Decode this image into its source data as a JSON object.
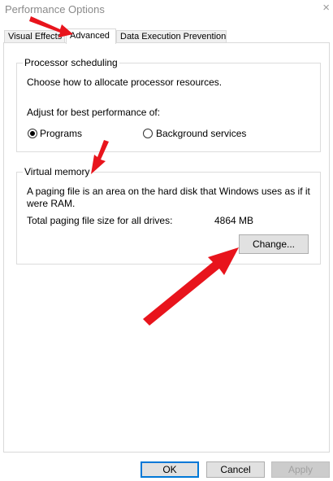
{
  "window": {
    "title": "Performance Options",
    "close_glyph": "×"
  },
  "tabs": [
    {
      "label": "Visual Effects"
    },
    {
      "label": "Advanced"
    },
    {
      "label": "Data Execution Prevention"
    }
  ],
  "processor_scheduling": {
    "title": "Processor scheduling",
    "description": "Choose how to allocate processor resources.",
    "adjust_label": "Adjust for best performance of:",
    "options": [
      {
        "label": "Programs",
        "selected": true
      },
      {
        "label": "Background services",
        "selected": false
      }
    ]
  },
  "virtual_memory": {
    "title": "Virtual memory",
    "description_line1": "A paging file is an area on the hard disk that Windows uses as if it",
    "description_line2": "were RAM.",
    "total_label": "Total paging file size for all drives:",
    "total_value": "4864 MB",
    "change_button": "Change..."
  },
  "footer": {
    "ok": "OK",
    "cancel": "Cancel",
    "apply": "Apply"
  },
  "colors": {
    "annotation_arrow": "#e8141c",
    "focus_border": "#0078d7"
  }
}
